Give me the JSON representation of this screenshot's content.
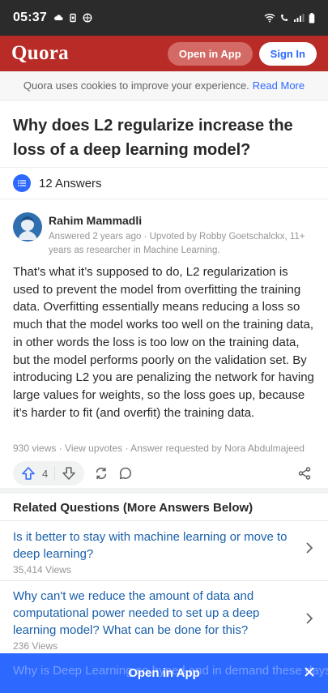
{
  "status_bar": {
    "time": "05:37"
  },
  "header": {
    "logo": "Quora",
    "open_in_app": "Open in App",
    "sign_in": "Sign In"
  },
  "cookie": {
    "text": "Quora uses cookies to improve your experience.",
    "link": "Read More"
  },
  "question": {
    "title": "Why does L2 regularize increase the loss of a deep learning model?"
  },
  "answers": {
    "count_label": "12 Answers"
  },
  "answer": {
    "author": "Rahim Mammadli",
    "meta": "Answered 2 years ago · Upvoted by Robby Goetschalckx, 11+ years as researcher in Machine Learning.",
    "body": "That’s what it’s supposed to do, L2 regularization is used to prevent the model from overfitting the training data. Overfitting essentially means reducing a loss so much that the model works too well on the training data, in other words the loss is too low on the training data, but the model performs poorly on the validation set. By introducing L2 you are penalizing the network for having large values for weights, so the loss goes up, because it’s harder to fit (and overfit) the training data.",
    "stats": "930 views · View upvotes · Answer requested by Nora Abdulmajeed",
    "upvotes": "4"
  },
  "related": {
    "title": "Related Questions (More Answers Below)",
    "items": [
      {
        "question": "Is it better to stay with machine learning or move to deep learning?",
        "views": "35,414 Views"
      },
      {
        "question": "Why can't we reduce the amount of data and computational power needed to set up a deep learning model? What can be done for this?",
        "views": "236 Views"
      }
    ],
    "partial": "Why is Deep Learning so hyped and in demand these days?"
  },
  "bottom": {
    "open_in_app": "Open in App"
  },
  "colors": {
    "brand": "#b92b27",
    "accent": "#2e69ff",
    "link": "#195faa"
  }
}
